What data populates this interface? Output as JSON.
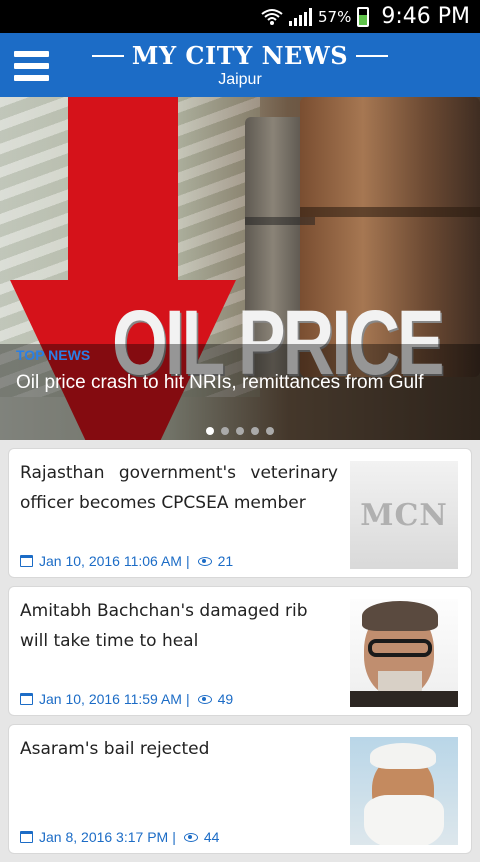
{
  "status_bar": {
    "battery_percent": "57%",
    "time": "9:46 PM",
    "icons": [
      "wifi-icon",
      "signal-icon",
      "battery-icon"
    ]
  },
  "header": {
    "title": "MY CITY NEWS",
    "city": "Jaipur",
    "menu_icon": "hamburger-menu-icon",
    "bg_color": "#1c6cc6"
  },
  "hero": {
    "tag": "TOP NEWS",
    "headline": "Oil price crash to hit NRIs, remittances from Gulf",
    "image_text": "OIL PRICE",
    "slide_count": 5,
    "active_slide": 0
  },
  "feed": [
    {
      "title": "Rajasthan government's veterinary officer becomes CPCSEA member",
      "date": "Jan 10, 2016 11:06 AM",
      "views": "21",
      "thumb_text": "MCN"
    },
    {
      "title": "Amitabh Bachchan's damaged rib will take time to heal",
      "date": "Jan 10, 2016 11:59 AM",
      "views": "49",
      "thumb_text": ""
    },
    {
      "title": "Asaram's bail rejected",
      "date": "Jan 8, 2016 3:17 PM",
      "views": "44",
      "thumb_text": ""
    }
  ],
  "meta_separator": "|",
  "colors": {
    "accent": "#1c6cc6",
    "tag": "#2a7fe6",
    "arrow": "#d5121a"
  }
}
